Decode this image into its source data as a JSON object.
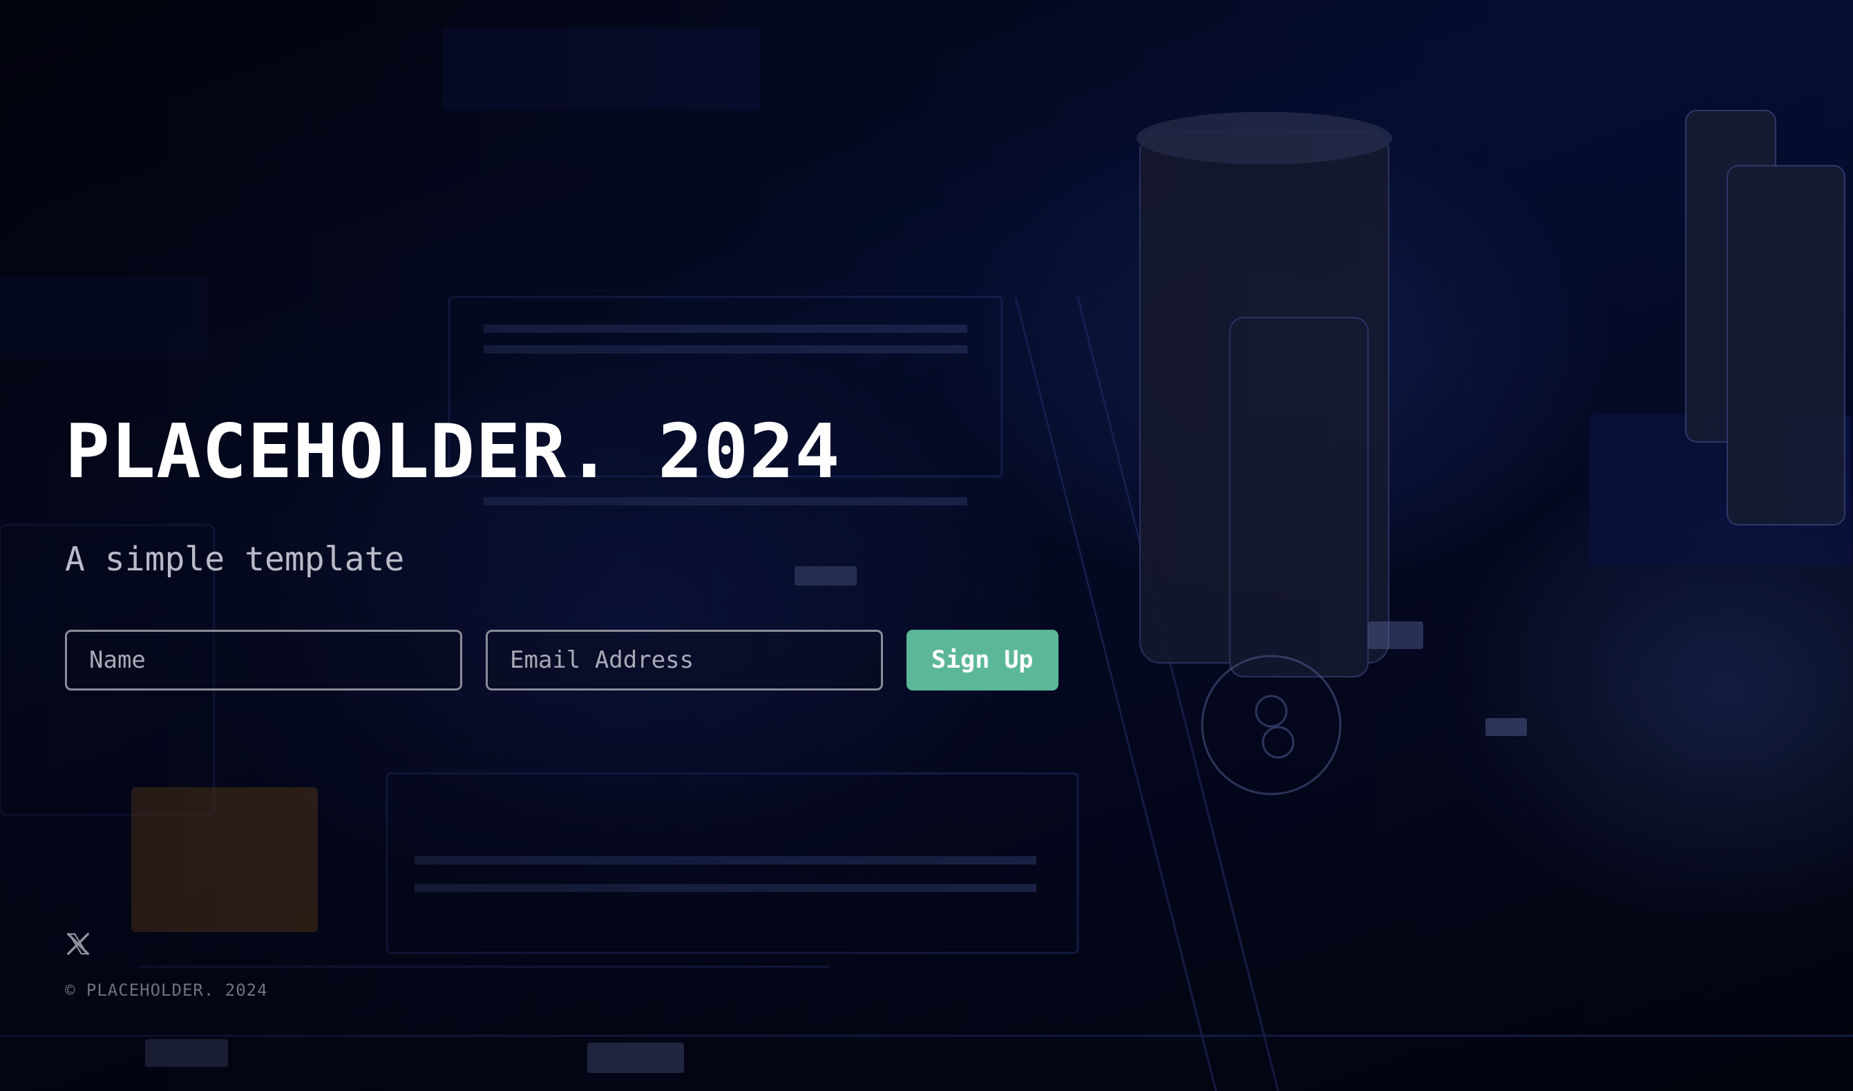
{
  "hero": {
    "title": "PLACEHOLDER. 2024",
    "subtitle": "A simple template"
  },
  "form": {
    "name_placeholder": "Name",
    "email_placeholder": "Email Address",
    "submit_label": "Sign Up"
  },
  "footer": {
    "social_icon": "x-icon",
    "copyright": "© PLACEHOLDER. 2024"
  },
  "colors": {
    "accent": "#5cb79a",
    "background": "#02040e",
    "title": "#ffffff",
    "subtitle": "#b9bcc8"
  }
}
